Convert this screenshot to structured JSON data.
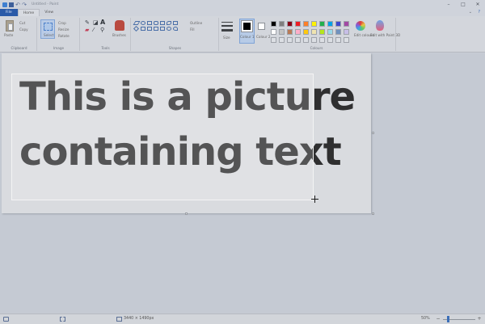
{
  "window": {
    "title": "Untitled - Paint",
    "minimize": "–",
    "maximize": "□",
    "close": "✕"
  },
  "tabs": [
    {
      "label": "File"
    },
    {
      "label": "Home"
    },
    {
      "label": "View"
    }
  ],
  "ribbon": {
    "clipboard": {
      "paste": "Paste",
      "cut": "Cut",
      "copy": "Copy",
      "group": "Clipboard"
    },
    "image": {
      "select": "Select",
      "crop": "Crop",
      "resize": "Resize",
      "rotate": "Rotate",
      "group": "Image"
    },
    "tools": {
      "brushes": "Brushes",
      "group": "Tools"
    },
    "shapes": {
      "outline": "Outline",
      "fill": "Fill",
      "group": "Shapes"
    },
    "size": {
      "label": "Size"
    },
    "colours": {
      "colour1": "Colour 1",
      "colour2": "Colour 2",
      "edit_colours": "Edit colours",
      "edit_paint3d": "Edit with Paint 3D",
      "group": "Colours",
      "palette": [
        "#000000",
        "#7f7f7f",
        "#880015",
        "#ed1c24",
        "#ff7f27",
        "#fff200",
        "#22b14c",
        "#00a2e8",
        "#3f48cc",
        "#a349a4",
        "#ffffff",
        "#c3c3c3",
        "#b97a57",
        "#ffaec9",
        "#ffc90e",
        "#efe4b0",
        "#b5e61d",
        "#99d9ea",
        "#7092be",
        "#c8bfe7"
      ]
    }
  },
  "canvas": {
    "text_line1": "This is a picture",
    "text_line2": "containing text"
  },
  "status": {
    "dimensions": "3440 × 1490px",
    "zoom": "50%"
  }
}
